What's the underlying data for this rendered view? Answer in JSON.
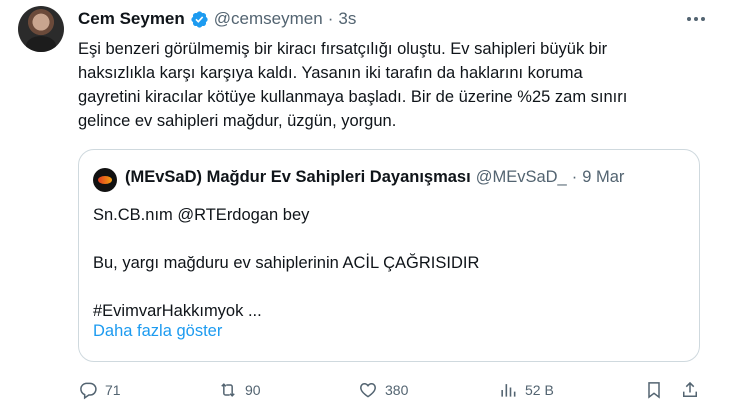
{
  "author": {
    "name": "Cem Seymen",
    "handle": "@cemseymen",
    "separator": "·",
    "time": "3s"
  },
  "tweet": {
    "text": "Eşi benzeri görülmemiş bir kiracı fırsatçılığı oluştu. Ev sahipleri büyük bir\nhaksızlıkla karşı karşıya kaldı. Yasanın iki tarafın da haklarını koruma\ngayretini kiracılar kötüye kullanmaya başladı. Bir de üzerine %25 zam sınırı\ngelince ev sahipleri mağdur, üzgün, yorgun."
  },
  "quote": {
    "name": "(MEvSaD) Mağdur Ev Sahipleri Dayanışması",
    "handle": "@MEvSaD_",
    "separator": "·",
    "time": "9 Mar",
    "text": "Sn.CB.nım @RTErdogan bey\n\nBu, yargı mağduru ev sahiplerinin ACİL ÇAĞRISIDIR\n\n#EvimvarHakkımyok ...",
    "show_more": "Daha fazla göster"
  },
  "actions": {
    "replies": "71",
    "retweets": "90",
    "likes": "380",
    "views": "52 B"
  },
  "colors": {
    "accent": "#1d9bf0",
    "muted": "#536471",
    "border": "#cfd9de",
    "text": "#0f1419"
  },
  "icons": [
    "verified-badge-icon",
    "more-icon",
    "reply-icon",
    "retweet-icon",
    "like-icon",
    "views-icon",
    "bookmark-icon",
    "share-icon"
  ]
}
